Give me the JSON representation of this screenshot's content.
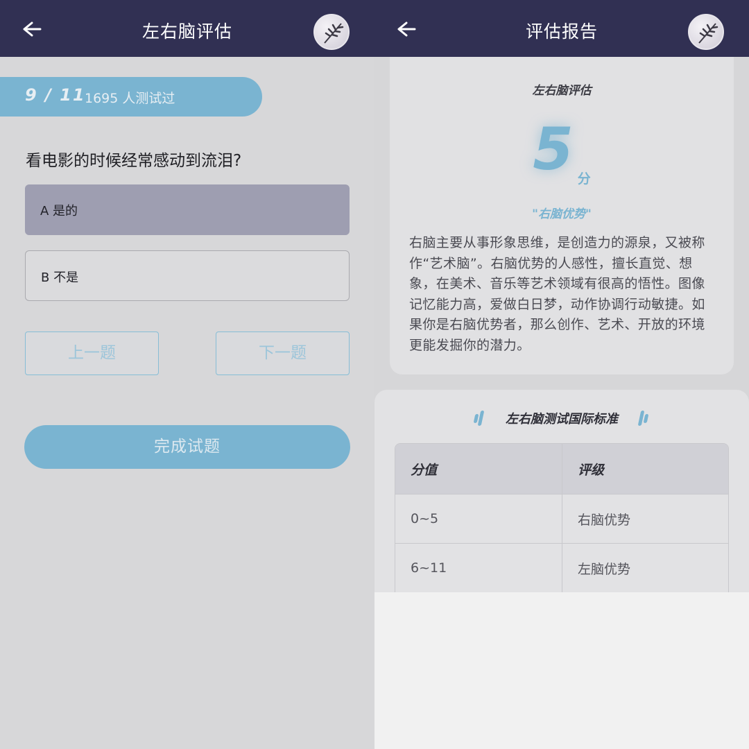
{
  "left": {
    "header": {
      "title": "左右脑评估"
    },
    "progress": {
      "position": "9 / 11",
      "tested_count": "1695 人测试过"
    },
    "question": "看电影的时候经常感动到流泪?",
    "options": [
      {
        "label": "A 是的",
        "selected": true
      },
      {
        "label": "B 不是",
        "selected": false
      }
    ],
    "nav": {
      "prev": "上一题",
      "next": "下一题"
    },
    "finish": "完成试题"
  },
  "right": {
    "header": {
      "title": "评估报告"
    },
    "result": {
      "title": "左右脑评估",
      "score": "5",
      "score_unit": "分",
      "label": "\"右脑优势\"",
      "description": "右脑主要从事形象思维，是创造力的源泉，又被称作“艺术脑”。右脑优势的人感性，擅长直觉、想象，在美术、音乐等艺术领域有很高的悟性。图像记忆能力高，爱做白日梦，动作协调行动敏捷。如果你是右脑优势者，那么创作、艺术、开放的环境更能发掘你的潜力。"
    },
    "standard": {
      "title": "左右脑测试国际标准",
      "headers": [
        "分值",
        "评级"
      ],
      "rows": [
        [
          "0~5",
          "右脑优势"
        ],
        [
          "6~11",
          "左脑优势"
        ]
      ]
    }
  },
  "colors": {
    "header_bg": "#313053",
    "accent": "#7ab4d1",
    "selected_option": "#9e9eb1"
  },
  "icons": [
    "back-arrow-icon",
    "avatar-branch-icon",
    "title-decoration-icon"
  ]
}
